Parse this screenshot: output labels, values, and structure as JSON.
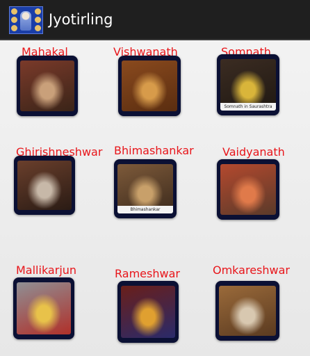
{
  "app": {
    "title": "Jyotirling",
    "icon": "shiva-app-icon"
  },
  "temples": [
    {
      "name": "Mahakal",
      "caption": "",
      "colors": [
        "#7a3a2a",
        "#c9a07a",
        "#3a2418"
      ]
    },
    {
      "name": "Vishwanath",
      "caption": "",
      "colors": [
        "#8a4a1e",
        "#d79b4a",
        "#5a2d10"
      ]
    },
    {
      "name": "Somnath",
      "caption": "Somnath in Saurashtra",
      "colors": [
        "#3b2c22",
        "#d9b53a",
        "#1f1812"
      ]
    },
    {
      "name": "Ghirishneshwar",
      "caption": "",
      "colors": [
        "#6a3f2c",
        "#c7b8a8",
        "#2a1b14"
      ]
    },
    {
      "name": "Bhimashankar",
      "caption": "Bhimashankar",
      "colors": [
        "#7d5a3a",
        "#c8a06a",
        "#3c2a1c"
      ]
    },
    {
      "name": "Vaidyanath",
      "caption": "",
      "colors": [
        "#b4492e",
        "#e07a4a",
        "#5a3a2a"
      ]
    },
    {
      "name": "Mallikarjun",
      "caption": "",
      "colors": [
        "#8f8f94",
        "#e8c24a",
        "#b0302a"
      ]
    },
    {
      "name": "Rameshwar",
      "caption": "",
      "colors": [
        "#6a1f1a",
        "#e0a030",
        "#2a2a6a"
      ]
    },
    {
      "name": "Omkareshwar",
      "caption": "",
      "colors": [
        "#9a6a3a",
        "#d8c8b0",
        "#5a3a20"
      ]
    }
  ]
}
